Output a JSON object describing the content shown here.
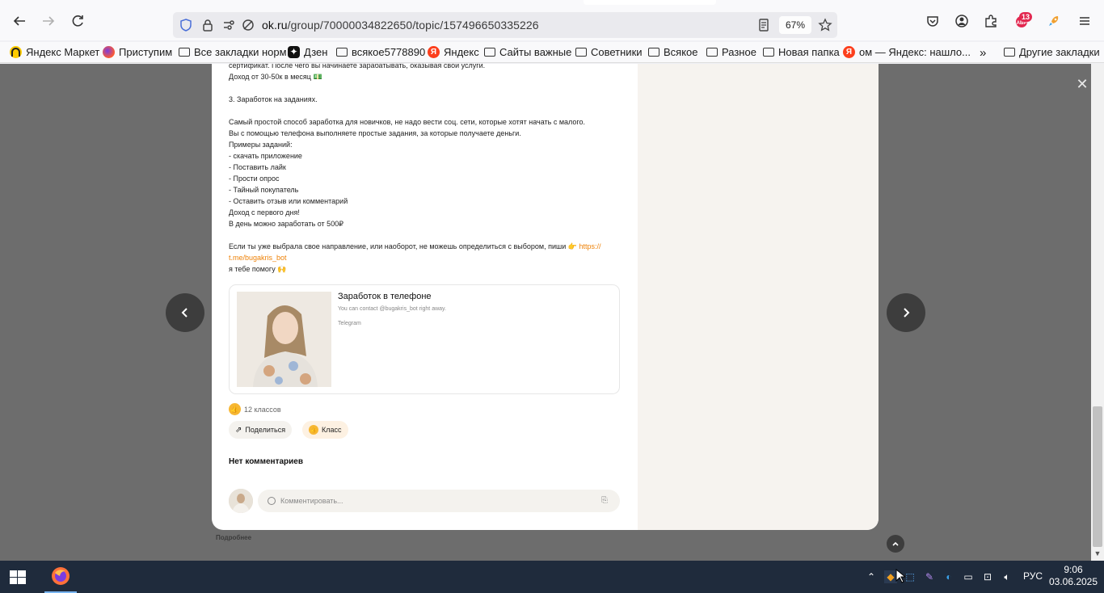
{
  "browser": {
    "url_prefix": "ok.ru",
    "url_path": "/group/70000034822650/topic/157496650335226",
    "zoom": "67%",
    "extension_badge": "13"
  },
  "bookmarks": [
    {
      "label": "Яндекс Маркет",
      "icon": "yandex-market-icon"
    },
    {
      "label": "Приступим",
      "icon": "firefox-icon"
    },
    {
      "label": "Все закладки норм",
      "icon": "folder-icon"
    },
    {
      "label": "Дзен",
      "icon": "dzen-icon"
    },
    {
      "label": "всякое5778890",
      "icon": "folder-icon"
    },
    {
      "label": "Яндекс",
      "icon": "yandex-icon"
    },
    {
      "label": "Сайты важные",
      "icon": "folder-icon"
    },
    {
      "label": "Советники",
      "icon": "folder-icon"
    },
    {
      "label": "Всякое",
      "icon": "folder-icon"
    },
    {
      "label": "Разное",
      "icon": "folder-icon"
    },
    {
      "label": "Новая папка",
      "icon": "folder-icon"
    },
    {
      "label": "ом — Яндекс: нашло...",
      "icon": "yandex-icon"
    },
    {
      "label": "Другие закладки",
      "icon": "folder-icon"
    }
  ],
  "post": {
    "lines": [
      "сертификат. После чего вы начинаете зарабатывать, оказывая свои услуги.",
      "Доход от 30-50к в месяц 💵",
      "",
      "3. Заработок на заданиях.",
      "",
      "Самый простой способ заработка для новичков, не надо вести соц. сети, которые хотят начать с малого.",
      "Вы с помощью телефона выполняете простые задания, за которые получаете деньги.",
      "Примеры заданий:",
      "- скачать приложение",
      "- Поставить лайк",
      "- Прости опрос",
      "- Тайный покупатель",
      "- Оставить отзыв или комментарий",
      "Доход с первого дня!",
      "В день можно заработать от 500₽",
      ""
    ],
    "cta_text": "Если ты уже выбрала свое направление, или наоборот, не можешь определиться с выбором, пиши 👉",
    "cta_link": "https://t.me/bugakris_bot",
    "cta_link_part1": "https://",
    "cta_link_part2": "t.me/bugakris_bot",
    "closing": "я тебе помогу 🙌"
  },
  "link_card": {
    "title": "Заработок в телефоне",
    "description": "You can contact @bugakris_bot right away.",
    "source": "Telegram"
  },
  "reactions": {
    "count_label": "12 классов"
  },
  "actions": {
    "share": "Поделиться",
    "like": "Класс"
  },
  "comments": {
    "empty_label": "Нет комментариев",
    "placeholder": "Комментировать..."
  },
  "page": {
    "more_label": "Подробнее"
  },
  "taskbar": {
    "language": "РУС",
    "time": "9:06",
    "date": "03.06.2025"
  },
  "colors": {
    "accent": "#ee8208",
    "overlay": "#6d6d6d",
    "taskbar": "#1f2b3c"
  }
}
